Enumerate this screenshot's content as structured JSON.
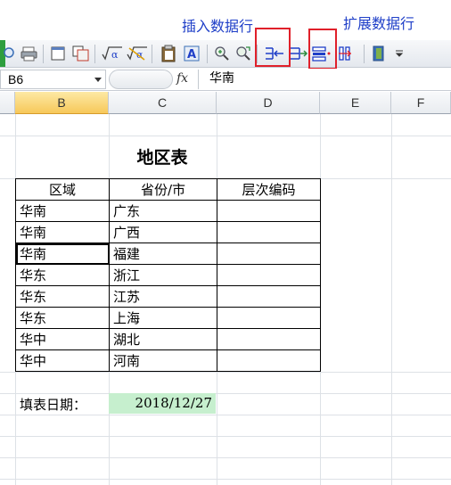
{
  "annotations": {
    "insert_row": "插入数据行",
    "extend_row": "扩展数据行"
  },
  "toolbar": {
    "icons": [
      "find-icon",
      "print-icon",
      "window-icon",
      "copy-window-icon",
      "sqrt-alpha-icon",
      "sqrt-alpha-x-icon",
      "clipboard-icon",
      "text-a-icon",
      "search-plus-icon",
      "search-replace-icon",
      "insert-row-icon",
      "arrow-row-icon",
      "extend-row-icon",
      "column-split-icon",
      "door-exit-icon",
      "more-dropdown-icon"
    ]
  },
  "formula_bar": {
    "cell_ref": "B6",
    "fx": "fx",
    "value": "华南"
  },
  "columns": [
    "B",
    "C",
    "D",
    "E",
    "F"
  ],
  "active_column": "B",
  "sheet": {
    "title": "地区表",
    "headers": [
      "区域",
      "省份/市",
      "层次编码"
    ],
    "rows": [
      [
        "华南",
        "广东",
        ""
      ],
      [
        "华南",
        "广西",
        ""
      ],
      [
        "华南",
        "福建",
        ""
      ],
      [
        "华东",
        "浙江",
        ""
      ],
      [
        "华东",
        "江苏",
        ""
      ],
      [
        "华东",
        "上海",
        ""
      ],
      [
        "华中",
        "湖北",
        ""
      ],
      [
        "华中",
        "河南",
        ""
      ]
    ],
    "footer_label": "填表日期：",
    "footer_date": "2018/12/27"
  },
  "colors": {
    "annotation": "#1f3fc8",
    "highlight_box": "#e0202a",
    "date_fill": "#c6efce",
    "active_header": "#f7c85a"
  }
}
